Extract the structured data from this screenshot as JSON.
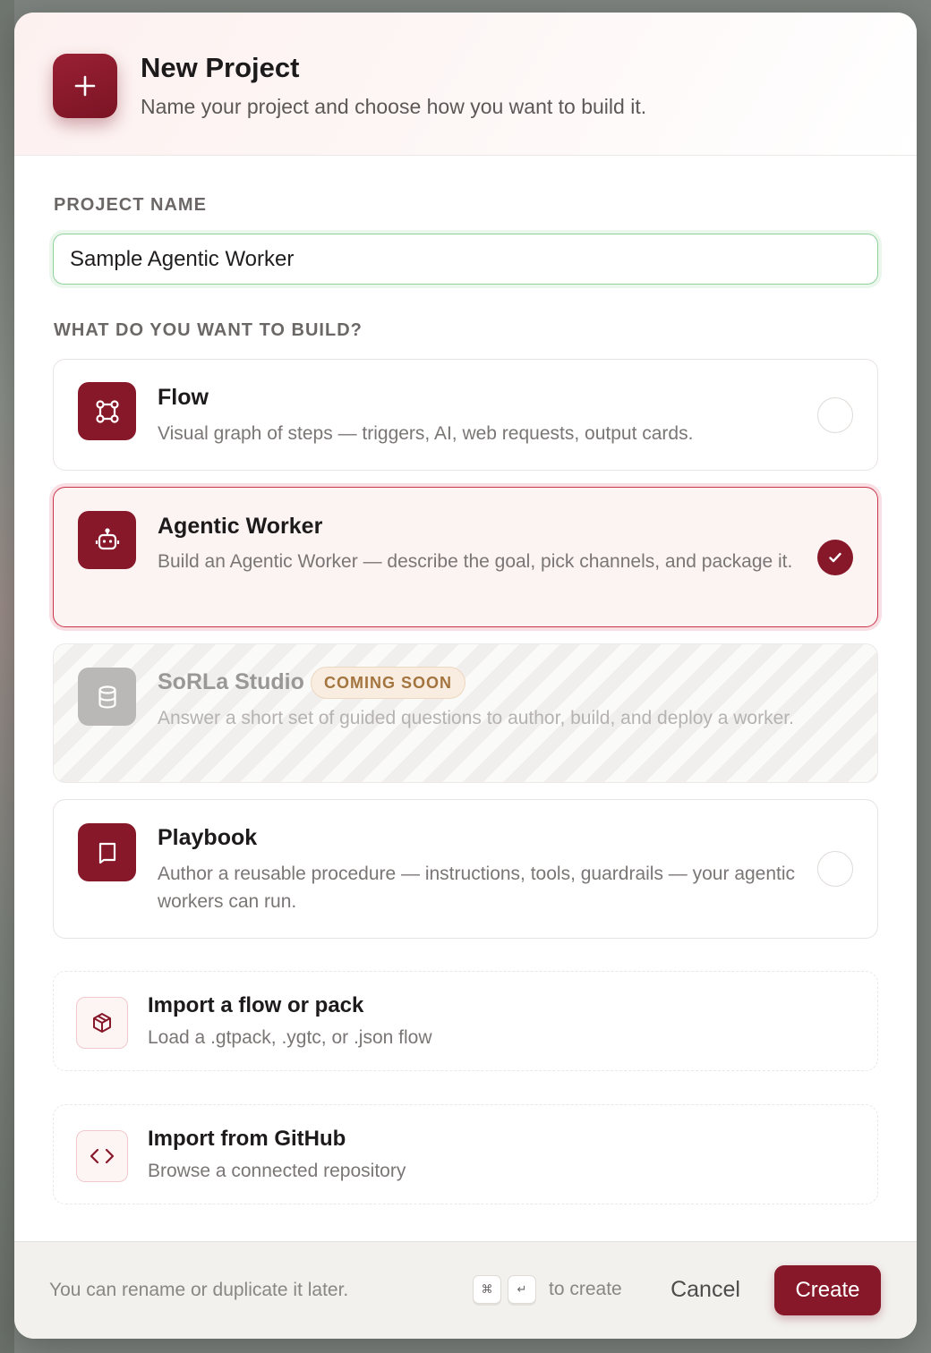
{
  "dialog": {
    "title": "New Project",
    "subtitle": "Name your project and choose how you want to build it."
  },
  "project_name": {
    "label": "PROJECT NAME",
    "value": "Sample Agentic Worker"
  },
  "build": {
    "label": "WHAT DO YOU WANT TO BUILD?",
    "options": [
      {
        "title": "Flow",
        "description": "Visual graph of steps — triggers, AI, web requests, output cards.",
        "icon": "flow-graph-icon",
        "state": "unselected"
      },
      {
        "title": "Agentic Worker",
        "description": "Build an Agentic Worker — describe the goal, pick channels, and package it.",
        "icon": "robot-icon",
        "state": "selected"
      },
      {
        "title": "SoRLa Studio",
        "badge": "COMING SOON",
        "description": "Answer a short set of guided questions to author, build, and deploy a worker.",
        "icon": "database-icon",
        "state": "disabled"
      },
      {
        "title": "Playbook",
        "description": "Author a reusable procedure — instructions, tools, guardrails — your agentic workers can run.",
        "icon": "book-icon",
        "state": "unselected"
      }
    ]
  },
  "imports": [
    {
      "title": "Import a flow or pack",
      "description": "Load a .gtpack, .ygtc, or .json flow",
      "icon": "package-icon"
    },
    {
      "title": "Import from GitHub",
      "description": "Browse a connected repository",
      "icon": "code-icon"
    }
  ],
  "footer": {
    "note": "You can rename or duplicate it later.",
    "kbd_cmd": "⌘",
    "kbd_enter": "↵",
    "kbd_text": "to create",
    "cancel_label": "Cancel",
    "create_label": "Create"
  },
  "colors": {
    "accent": "#86182a",
    "selected_border": "#c9364c",
    "input_focus": "#8fd19a",
    "badge_text": "#a3743e"
  }
}
